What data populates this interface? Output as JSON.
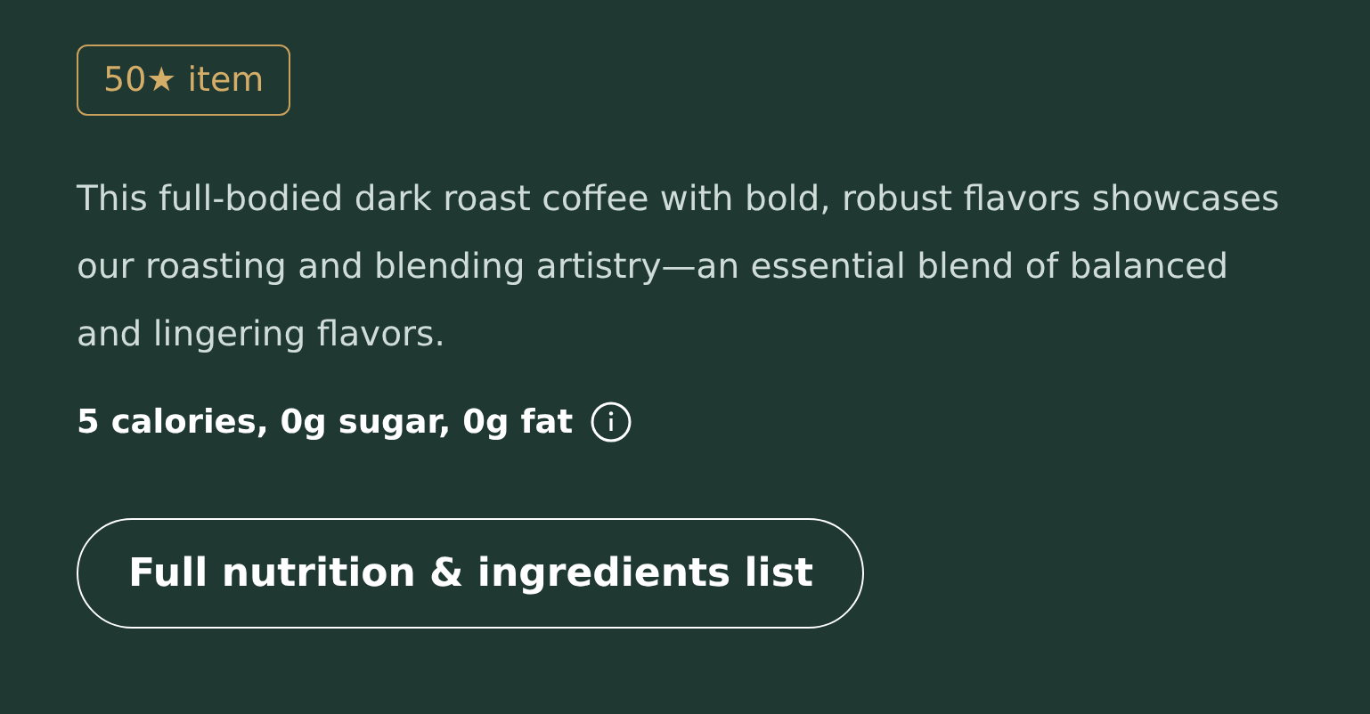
{
  "badge": "50★ item",
  "description": "This full-bodied dark roast coffee with bold, robust flavors showcases our roasting and blending artistry—an essential blend of balanced and lingering flavors.",
  "nutrition_summary": "5 calories, 0g sugar, 0g fat",
  "button": "Full nutrition & ingredients list"
}
